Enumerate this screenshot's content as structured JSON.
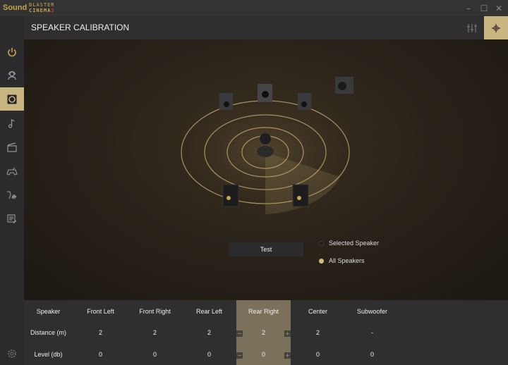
{
  "app": {
    "logo_sound": "Sound",
    "logo_blaster": "BLASTER",
    "logo_cinema": "CINEMA",
    "logo_version": "3"
  },
  "window": {
    "minimize": "–",
    "maximize": "☐",
    "close": "✕"
  },
  "header": {
    "title": "SPEAKER CALIBRATION"
  },
  "sidebar": {
    "items": [
      {
        "icon": "power-icon"
      },
      {
        "icon": "headset-user-icon"
      },
      {
        "icon": "speaker-icon",
        "active": true
      },
      {
        "icon": "music-note-icon"
      },
      {
        "icon": "clapperboard-icon"
      },
      {
        "icon": "gamepad-icon"
      },
      {
        "icon": "voice-wave-icon"
      },
      {
        "icon": "notes-edit-icon"
      }
    ],
    "settings_icon": "gear-icon"
  },
  "header_buttons": [
    {
      "icon": "equalizer-sliders-icon"
    },
    {
      "icon": "crosshair-icon",
      "active": true
    }
  ],
  "stage": {
    "test_label": "Test",
    "mode_options": [
      {
        "label": "Selected Speaker",
        "selected": false
      },
      {
        "label": "All Speakers",
        "selected": true
      }
    ]
  },
  "table": {
    "headers": [
      "Speaker",
      "Front Left",
      "Front Right",
      "Rear Left",
      "Rear Right",
      "Center",
      "Subwoofer"
    ],
    "rows": [
      {
        "label": "Distance (m)",
        "values": [
          "2",
          "2",
          "2",
          "2",
          "2",
          "-"
        ]
      },
      {
        "label": "Level (db)",
        "values": [
          "0",
          "0",
          "0",
          "0",
          "0",
          "0"
        ]
      }
    ],
    "selected_column": "Rear Right",
    "minus": "−",
    "plus": "+"
  },
  "colors": {
    "accent": "#c9b57f",
    "logo": "#c9a44a",
    "selected_column": "#7b705a",
    "ring": "#c8aa6a"
  }
}
